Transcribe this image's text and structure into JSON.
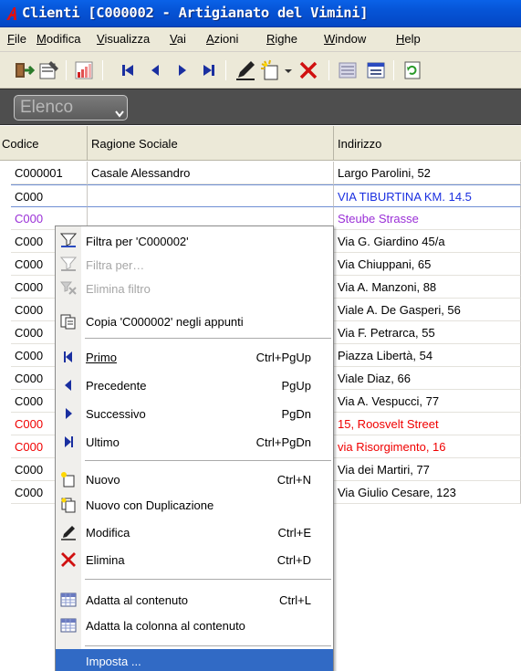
{
  "window": {
    "title": "Clienti [C000002 - Artigianato del Vimini]",
    "app_icon": "red-a-logo-icon"
  },
  "menubar": [
    "File",
    "Modifica",
    "Visualizza",
    "Vai",
    "Azioni",
    "Righe",
    "Window",
    "Help"
  ],
  "toolbar": {
    "icons": [
      "exit-door-icon",
      "properties-icon",
      "chart-icon",
      "first-record-icon",
      "previous-record-icon",
      "next-record-icon",
      "last-record-icon",
      "edit-pencil-icon",
      "new-record-icon",
      "dropdown-arrow-icon",
      "delete-x-icon",
      "list-view-icon",
      "form-view-icon",
      "refresh-icon"
    ]
  },
  "tabs": {
    "active": "Elenco"
  },
  "grid": {
    "columns": [
      "Codice",
      "Ragione Sociale",
      "Indirizzo"
    ],
    "rows": [
      {
        "code": "C000001",
        "name": "Casale Alessandro",
        "address": "Largo Parolini, 52",
        "style": "normal"
      },
      {
        "code": "C000",
        "name": "",
        "address": "VIA TIBURTINA KM. 14.5",
        "style": "selected"
      },
      {
        "code": "C000",
        "name": "",
        "address": "Steube Strasse",
        "style": "purple"
      },
      {
        "code": "C000",
        "name": "",
        "address": "Via G. Giardino 45/a",
        "style": "normal"
      },
      {
        "code": "C000",
        "name": "",
        "address": "Via Chiuppani, 65",
        "style": "normal"
      },
      {
        "code": "C000",
        "name": "",
        "address": "Via A. Manzoni, 88",
        "style": "normal"
      },
      {
        "code": "C000",
        "name": "",
        "address": "Viale A. De Gasperi, 56",
        "style": "normal"
      },
      {
        "code": "C000",
        "name": "",
        "address": "Via F. Petrarca, 55",
        "style": "normal"
      },
      {
        "code": "C000",
        "name": "",
        "address": "Piazza Libertà, 54",
        "style": "normal"
      },
      {
        "code": "C000",
        "name": "",
        "address": "Viale Diaz, 66",
        "style": "normal"
      },
      {
        "code": "C000",
        "name": "",
        "address": "Via A. Vespucci, 77",
        "style": "normal"
      },
      {
        "code": "C000",
        "name": "",
        "address": "15, Roosvelt Street",
        "style": "red"
      },
      {
        "code": "C000",
        "name": "",
        "address": "via Risorgimento, 16",
        "style": "red"
      },
      {
        "code": "C000",
        "name": "",
        "address": "Via dei Martiri, 77",
        "style": "normal"
      },
      {
        "code": "C000",
        "name": "",
        "address": "Via Giulio Cesare, 123",
        "style": "normal"
      }
    ]
  },
  "context_menu": {
    "filter_by": "Filtra per 'C000002'",
    "filter_by_ellipsis": "Filtra per…",
    "remove_filter": "Elimina filtro",
    "copy": "Copia 'C000002' negli appunti",
    "first": "Primo",
    "first_shortcut": "Ctrl+PgUp",
    "previous": "Precedente",
    "previous_shortcut": "PgUp",
    "next": "Successivo",
    "next_shortcut": "PgDn",
    "last": "Ultimo",
    "last_shortcut": "Ctrl+PgDn",
    "new": "Nuovo",
    "new_shortcut": "Ctrl+N",
    "new_dup": "Nuovo con Duplicazione",
    "edit": "Modifica",
    "edit_shortcut": "Ctrl+E",
    "delete": "Elimina",
    "delete_shortcut": "Ctrl+D",
    "fit_content": "Adatta al contenuto",
    "fit_content_shortcut": "Ctrl+L",
    "fit_column": "Adatta la colonna al contenuto",
    "setup": "Imposta ..."
  },
  "colors": {
    "title_bar": "#0654d6",
    "highlight": "#316ac5",
    "purple_text": "#9a2fd7",
    "red_text": "#f00000",
    "selected_text": "#1a2fe0"
  }
}
